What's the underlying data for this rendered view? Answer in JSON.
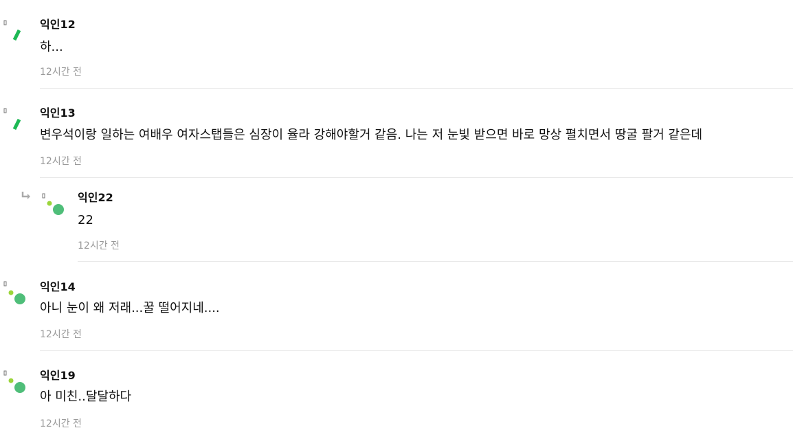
{
  "comments": [
    {
      "author": "익인12",
      "text": "하...",
      "time": "12시간 전",
      "avatar": "leaf-avatar-icon"
    },
    {
      "author": "익인13",
      "text": "변우석이랑 일하는 여배우 여자스탭들은 심장이 율라 강해야할거 같음. 나는 저 눈빛 받으면 바로 망상 펼치면서 땅굴 팔거 같은데",
      "time": "12시간 전",
      "avatar": "leaf-avatar-icon"
    },
    {
      "author": "익인22",
      "text": "22",
      "time": "12시간 전",
      "avatar": "green-dots-avatar-icon",
      "reply": true
    },
    {
      "author": "익인14",
      "text": "아니 눈이 왜 저래...꿀 떨어지네....",
      "time": "12시간 전",
      "avatar": "green-dots-avatar-icon"
    },
    {
      "author": "익인19",
      "text": "아 미친..달달하다",
      "time": "12시간 전",
      "avatar": "green-dots-avatar-icon"
    }
  ],
  "colors": {
    "leaf": "#1db954",
    "dot_small": "#9bd53a",
    "dot_large": "#4fbe79",
    "muted": "#999999",
    "divider": "#e8e8e8"
  }
}
